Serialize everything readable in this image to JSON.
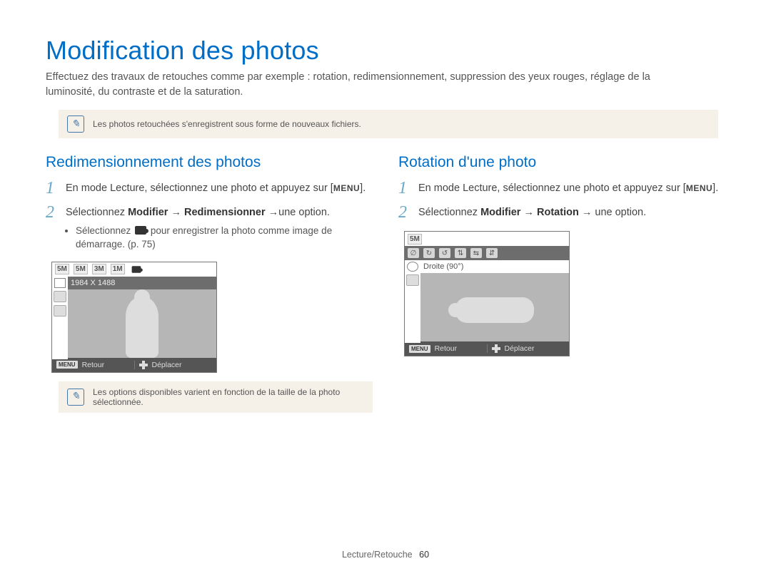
{
  "page": {
    "title": "Modification des photos",
    "intro": "Effectuez des travaux de retouches comme par exemple : rotation, redimensionnement, suppression des yeux rouges, réglage de la luminosité, du contraste et de la saturation."
  },
  "notes": {
    "top": "Les photos retouchées s'enregistrent sous forme de nouveaux fichiers.",
    "bottom": "Les options disponibles varient en fonction de la taille de la photo sélectionnée."
  },
  "left": {
    "heading": "Redimensionnement des photos",
    "step1_pre": "En mode Lecture, sélectionnez une photo et appuyez sur [",
    "step1_menu": "MENU",
    "step1_post": "].",
    "step2_pre": "Sélectionnez ",
    "step2_b1": "Modifier",
    "step2_arrow1": " → ",
    "step2_b2": "Redimensionner",
    "step2_arrow2": " →",
    "step2_post": "une option.",
    "bullet_pre": "Sélectionnez ",
    "bullet_post": " pour enregistrer la photo comme image de démarrage. (p. 75)",
    "lcd": {
      "top_labels": [
        "5M",
        "5M",
        "3M",
        "1M"
      ],
      "info": "1984 X 1488",
      "back_label": "Retour",
      "move_label": "Déplacer",
      "menu_btn": "MENU"
    }
  },
  "right": {
    "heading": "Rotation d'une photo",
    "step1_pre": "En mode Lecture, sélectionnez une photo et appuyez sur [",
    "step1_menu": "MENU",
    "step1_post": "].",
    "step2_pre": "Sélectionnez ",
    "step2_b1": "Modifier",
    "step2_arrow1": " → ",
    "step2_b2": "Rotation",
    "step2_arrow2": " → ",
    "step2_post": "une option.",
    "lcd": {
      "top_labels": [
        "5M"
      ],
      "info": "Droite (90°)",
      "back_label": "Retour",
      "move_label": "Déplacer",
      "menu_btn": "MENU"
    }
  },
  "footer": {
    "section": "Lecture/Retouche",
    "page_number": "60"
  }
}
